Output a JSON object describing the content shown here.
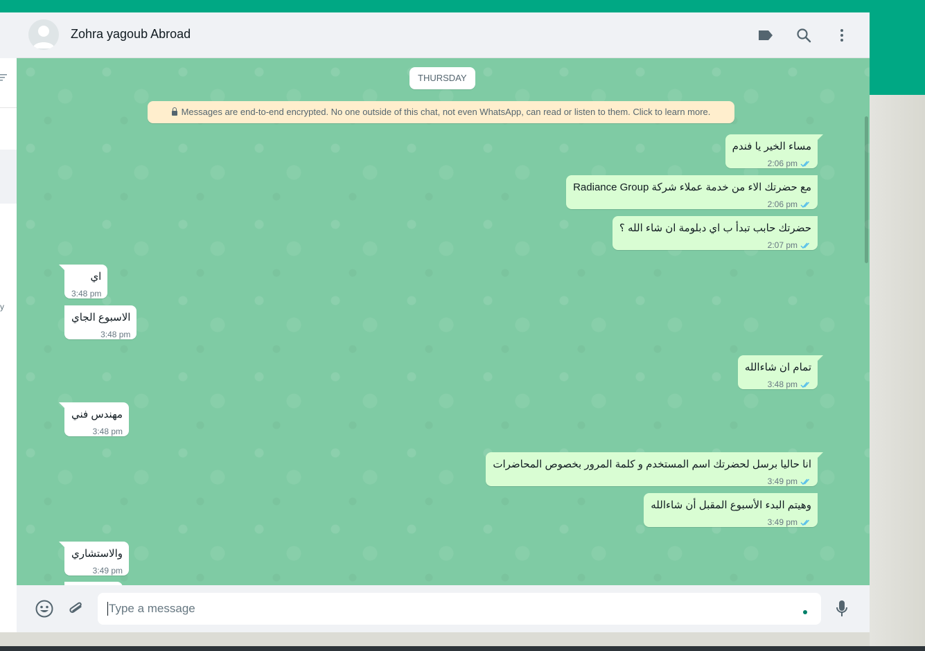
{
  "contact": {
    "name": "Zohra yagoub Abroad"
  },
  "header": {
    "label_icon": "label-tag-icon",
    "search_icon": "search-icon",
    "menu_icon": "kebab-menu-icon"
  },
  "left_panel": {
    "cut_text": "y"
  },
  "chat": {
    "day": "THURSDAY",
    "encryption_notice": "Messages are end-to-end encrypted. No one outside of this chat, not even WhatsApp, can read or listen to them. Click to learn more.",
    "messages": [
      {
        "dir": "out",
        "text": "مساء الخير يا فندم",
        "time": "2:06 pm",
        "status": "read"
      },
      {
        "dir": "out",
        "text": "مع حضرتك الاء من خدمة عملاء شركة Radiance Group",
        "time": "2:06 pm",
        "status": "read"
      },
      {
        "dir": "out",
        "text": "حضرتك حابب تبدأ ب اي دبلومة ان شاء الله ؟",
        "time": "2:07 pm",
        "status": "read"
      },
      {
        "dir": "in",
        "text": "اي",
        "time": "3:48 pm"
      },
      {
        "dir": "in",
        "text": "الاسبوع الجاي",
        "time": "3:48 pm"
      },
      {
        "dir": "out",
        "text": "تمام ان شاءالله",
        "time": "3:48 pm",
        "status": "read"
      },
      {
        "dir": "in",
        "text": "مهندس فني",
        "time": "3:48 pm"
      },
      {
        "dir": "out",
        "text": "انا حاليا برسل لحضرتك اسم المستخدم و كلمة المرور بخصوص المحاضرات",
        "time": "3:49 pm",
        "status": "read"
      },
      {
        "dir": "out",
        "text": "وهيتم البدء الأسبوع المقبل أن شاءالله",
        "time": "3:49 pm",
        "status": "read"
      },
      {
        "dir": "in",
        "text": "والاستشاري",
        "time": "3:49 pm"
      }
    ]
  },
  "composer": {
    "placeholder": "Type a message",
    "emoji_icon": "emoji-icon",
    "attach_icon": "paperclip-icon",
    "mic_icon": "microphone-icon"
  },
  "colors": {
    "accent": "#00a884",
    "outgoing_bubble": "#d9fdd3",
    "incoming_bubble": "#ffffff",
    "chat_wallpaper": "#7fcba4",
    "read_ticks": "#53bdeb"
  }
}
